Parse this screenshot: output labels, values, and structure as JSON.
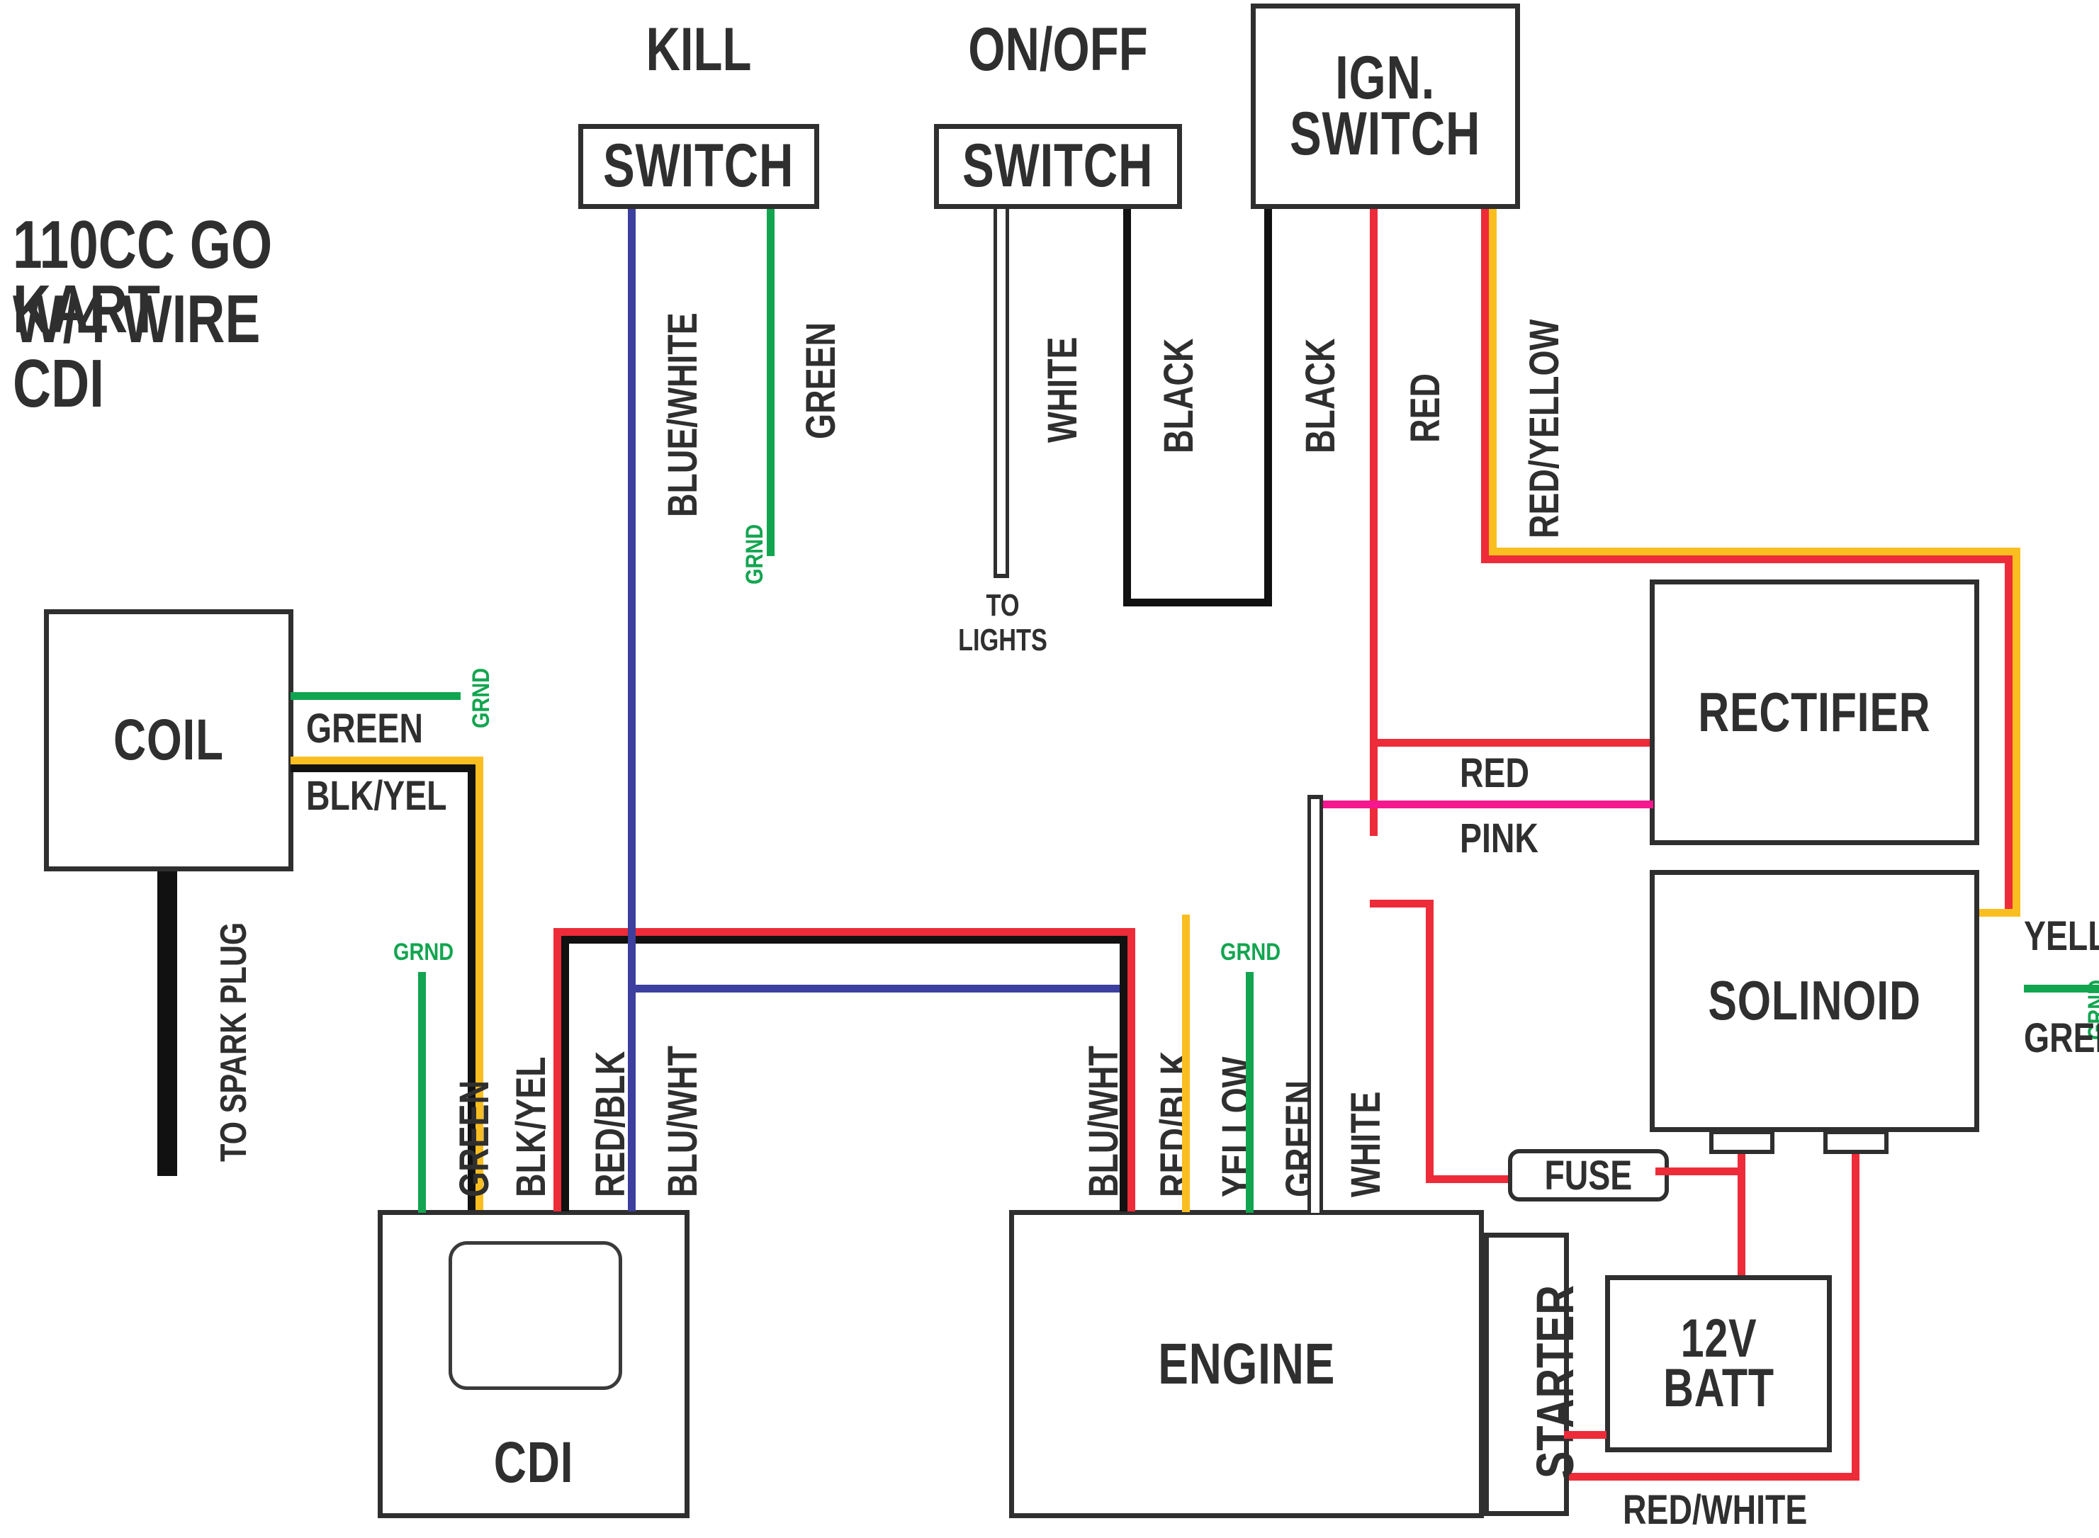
{
  "title": {
    "line1": "110CC GO KART",
    "line2": "W/4 WIRE CDI"
  },
  "colors": {
    "ink": "#2f2f2f",
    "red": "#ee2b38",
    "yellow": "#fbbe20",
    "green": "#12a550",
    "blue": "#3c3f9e",
    "pink": "#f5178e",
    "black": "#111111",
    "white": "#ffffff"
  },
  "components": [
    {
      "id": "kill-switch",
      "label": "KILL\nSWITCH",
      "caption": "KILL",
      "box_label": "SWITCH"
    },
    {
      "id": "onoff-switch",
      "label": "ON/OFF\nSWITCH",
      "caption": "ON/OFF",
      "box_label": "SWITCH"
    },
    {
      "id": "ign-switch",
      "label": "IGN.\nSWITCH",
      "caption": "",
      "box_label": "IGN.\nSWITCH"
    },
    {
      "id": "coil",
      "label": "COIL",
      "caption": "",
      "box_label": "COIL"
    },
    {
      "id": "cdi",
      "label": "CDI",
      "caption": "",
      "box_label": "CDI"
    },
    {
      "id": "engine",
      "label": "ENGINE",
      "caption": "",
      "box_label": "ENGINE"
    },
    {
      "id": "starter",
      "label": "STARTER",
      "caption": "",
      "box_label": "STARTER"
    },
    {
      "id": "rectifier",
      "label": "RECTIFIER",
      "caption": "",
      "box_label": "RECTIFIER"
    },
    {
      "id": "solinoid",
      "label": "SOLINOID",
      "caption": "",
      "box_label": "SOLINOID"
    },
    {
      "id": "battery",
      "label": "12V\nBATT",
      "caption": "",
      "box_label": "12V\nBATT"
    },
    {
      "id": "fuse",
      "label": "FUSE",
      "caption": "",
      "box_label": "FUSE"
    }
  ],
  "labels": {
    "kill_switch_caption": "KILL",
    "kill_switch_box": "SWITCH",
    "onoff_switch_caption": "ON/OFF",
    "onoff_switch_box": "SWITCH",
    "ign_switch_box": "IGN.\nSWITCH",
    "coil": "COIL",
    "cdi": "CDI",
    "engine": "ENGINE",
    "starter": "STARTER",
    "rectifier": "RECTIFIER",
    "solinoid": "SOLINOID",
    "battery": "12V\nBATT",
    "fuse": "FUSE"
  },
  "wire_labels": {
    "kill_blue_white": "BLUE/WHITE",
    "kill_green": "GREEN",
    "kill_green_grnd": "GRND",
    "onoff_white": "WHITE",
    "onoff_to_lights": "TO\nLIGHTS",
    "onoff_black": "BLACK",
    "ign_black": "BLACK",
    "ign_red": "RED",
    "ign_red_yellow": "RED/YELLOW",
    "coil_green": "GREEN",
    "coil_green_grnd": "GRND",
    "coil_blk_yel": "BLK/YEL",
    "coil_to_spark_plug": "TO SPARK PLUG",
    "cdi_green": "GREEN",
    "cdi_green_grnd": "GRND",
    "cdi_blk_yel": "BLK/YEL",
    "cdi_red_blk": "RED/BLK",
    "cdi_blu_wht": "BLU/WHT",
    "engine_blu_wht": "BLU/WHT",
    "engine_red_blk": "RED/BLK",
    "engine_yellow": "YELLOW",
    "engine_green": "GREEN",
    "engine_green_grnd": "GRND",
    "engine_white": "WHITE",
    "rect_red": "RED",
    "rect_pink": "PINK",
    "sol_yellow": "YELLOW",
    "sol_green": "GREEN",
    "sol_green_grnd": "GRND",
    "batt_red_white": "RED/WHITE"
  }
}
